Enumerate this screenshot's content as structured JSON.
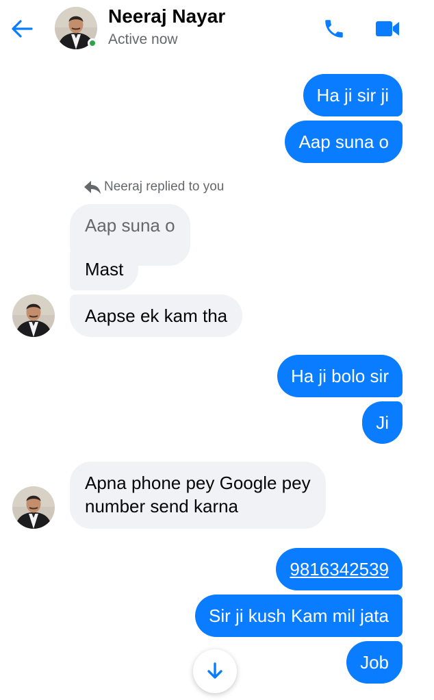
{
  "header": {
    "contact_name": "Neeraj Nayar",
    "status": "Active now",
    "icons": {
      "back": "back-arrow-icon",
      "call": "phone-icon",
      "video": "video-camera-icon"
    },
    "accent_color": "#0a7cff",
    "online_color": "#31a24c"
  },
  "reply_note": "Neeraj replied to you",
  "messages": [
    {
      "from": "me",
      "text": "Ha ji sir ji"
    },
    {
      "from": "me",
      "text": "Aap suna o"
    },
    {
      "from": "them",
      "type": "quoted",
      "text": "Aap suna o"
    },
    {
      "from": "them",
      "text": "Mast"
    },
    {
      "from": "them",
      "text": "Aapse ek kam tha"
    },
    {
      "from": "me",
      "text": "Ha ji bolo sir"
    },
    {
      "from": "me",
      "text": "Ji"
    },
    {
      "from": "them",
      "text_line1": "Apna phone pey Google pey",
      "text_line2": "number send karna"
    },
    {
      "from": "me",
      "type": "link",
      "text": "9816342539"
    },
    {
      "from": "me",
      "text": "Sir ji kush Kam mil jata"
    },
    {
      "from": "me",
      "text": "Job"
    }
  ],
  "colors": {
    "outgoing_bubble": "#0a7cff",
    "incoming_bubble": "#f0f2f5",
    "secondary_text": "#65676b"
  }
}
